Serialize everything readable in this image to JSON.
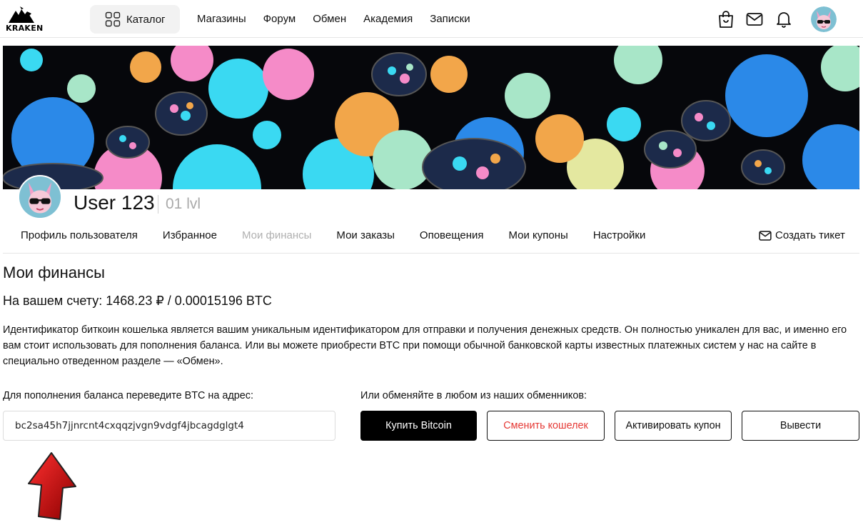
{
  "header": {
    "logo_text": "KRAKEN",
    "catalog_label": "Каталог",
    "nav": [
      "Магазины",
      "Форум",
      "Обмен",
      "Академия",
      "Записки"
    ],
    "icons": [
      "shopping-bag-icon",
      "mail-icon",
      "bell-icon",
      "user-avatar"
    ]
  },
  "profile": {
    "username": "User 123",
    "level": "01 lvl"
  },
  "tabs": {
    "items": [
      "Профиль пользователя",
      "Избранное",
      "Мои финансы",
      "Мои заказы",
      "Оповещения",
      "Мои купоны",
      "Настройки"
    ],
    "active": "Мои финансы",
    "ticket_label": "Создать тикет"
  },
  "finance": {
    "title": "Мои финансы",
    "balance_label": "На вашем счету:",
    "balance_value": "1468.23 ₽ / 0.00015196 BTC",
    "description": "Идентификатор биткоин кошелька является вашим уникальным идентификатором для отправки и получения денежных средств. Он полностью уникален для вас, и именно его вам стоит использовать для пополнения баланса. Или вы можете приобрести BTC при помощи обычной банковской карты известных платежных систем у нас на сайте в специально отведенном разделе — «Обмен».",
    "address_label": "Для пополнения баланса переведите BTC на адрес:",
    "address": "bc2sa45h7jjnrcnt4cxqqzjvgn9vdgf4jbcagdglgt4",
    "exchange_label": "Или обменяйте в любом из наших обменников:",
    "buttons": {
      "buy": "Купить Bitcoin",
      "change_wallet": "Сменить кошелек",
      "activate_coupon": "Активировать купон",
      "withdraw": "Вывести"
    }
  },
  "colors": {
    "accent_red": "#e53935",
    "black": "#000000",
    "muted": "#b0b0b0"
  }
}
